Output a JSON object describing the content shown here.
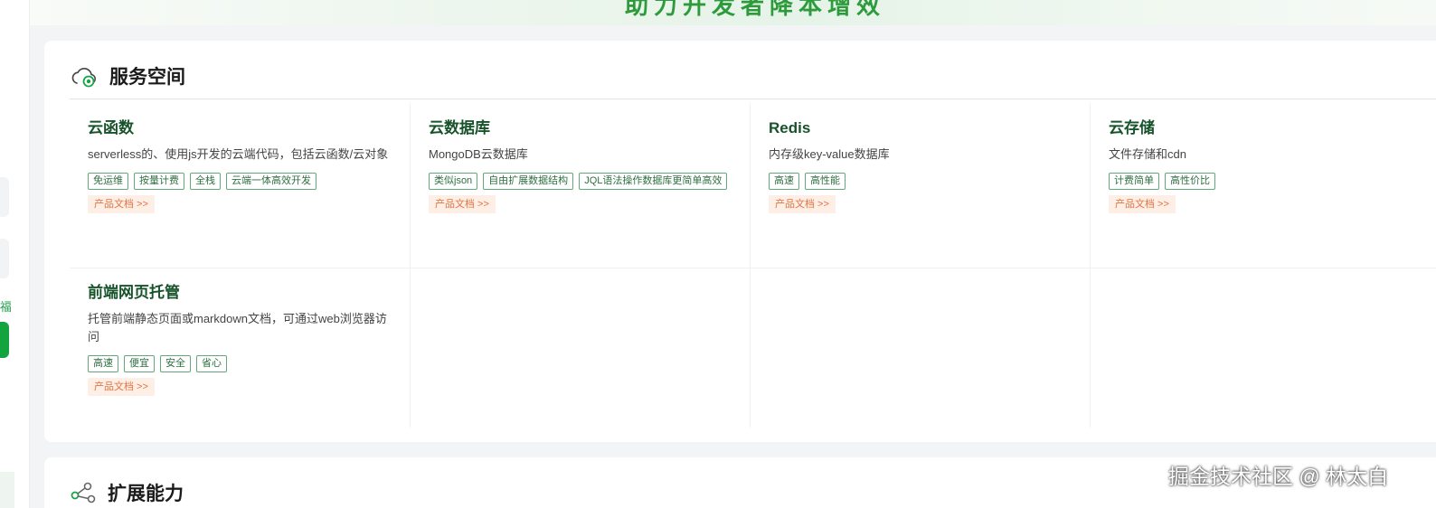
{
  "banner": {
    "title": "助力开发者降本增效"
  },
  "sidebar": {
    "partial_label": "福"
  },
  "section": {
    "title": "服务空间"
  },
  "items": [
    {
      "title": "云函数",
      "desc": "serverless的、使用js开发的云端代码，包括云函数/云对象",
      "tags": [
        "免运维",
        "按量计费",
        "全栈",
        "云端一体高效开发"
      ],
      "doc": "产品文档 >>"
    },
    {
      "title": "云数据库",
      "desc": "MongoDB云数据库",
      "tags": [
        "类似json",
        "自由扩展数据结构",
        "JQL语法操作数据库更简单高效"
      ],
      "doc": "产品文档 >>"
    },
    {
      "title": "Redis",
      "desc": "内存级key-value数据库",
      "tags": [
        "高速",
        "高性能"
      ],
      "doc": "产品文档 >>"
    },
    {
      "title": "云存储",
      "desc": "文件存储和cdn",
      "tags": [
        "计费简单",
        "高性价比"
      ],
      "doc": "产品文档 >>"
    },
    {
      "title": "前端网页托管",
      "desc": "托管前端静态页面或markdown文档，可通过web浏览器访问",
      "tags": [
        "高速",
        "便宜",
        "安全",
        "省心"
      ],
      "doc": "产品文档 >>"
    }
  ],
  "section2": {
    "title": "扩展能力"
  },
  "watermark": "掘金技术社区 @ 林太白",
  "colors": {
    "accent": "#13a440",
    "title_green": "#17532a",
    "doc_orange": "#e5733f"
  }
}
